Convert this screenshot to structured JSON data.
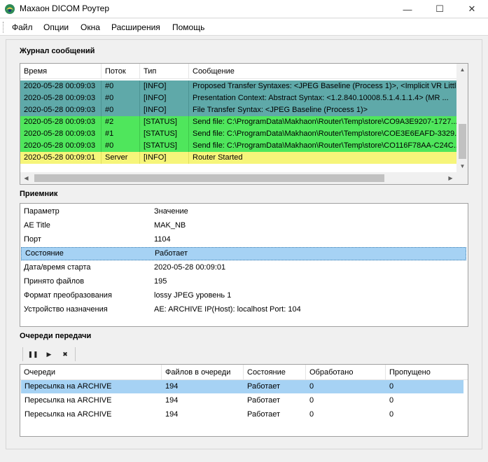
{
  "window": {
    "title": "Махаон DICOM Роутер",
    "minimize": "—",
    "maximize": "☐",
    "close": "✕"
  },
  "menu": [
    "Файл",
    "Опции",
    "Окна",
    "Расширения",
    "Помощь"
  ],
  "log": {
    "title": "Журнал сообщений",
    "columns": [
      "Время",
      "Поток",
      "Тип",
      "Сообщение"
    ],
    "rows": [
      {
        "time": "2020-05-28 00:09:03",
        "thread": "#0",
        "type": "[INFO]",
        "message": "Proposed Transfer Syntaxes: <JPEG Baseline (Process 1)>, <Implicit VR Littl...",
        "color": "#5fa9a9"
      },
      {
        "time": "2020-05-28 00:09:03",
        "thread": "#0",
        "type": "[INFO]",
        "message": "Presentation Context: Abstract Syntax: <1.2.840.10008.5.1.4.1.1.4> (MR ...",
        "color": "#5fa9a9"
      },
      {
        "time": "2020-05-28 00:09:03",
        "thread": "#0",
        "type": "[INFO]",
        "message": "File Transfer Syntax: <JPEG Baseline (Process 1)>",
        "color": "#5fa9a9"
      },
      {
        "time": "2020-05-28 00:09:03",
        "thread": "#2",
        "type": "[STATUS]",
        "message": "Send file: C:\\ProgramData\\Makhaon\\Router\\Temp\\store\\CO9A3E9207-1727...",
        "color": "#4fe65c"
      },
      {
        "time": "2020-05-28 00:09:03",
        "thread": "#1",
        "type": "[STATUS]",
        "message": "Send file: C:\\ProgramData\\Makhaon\\Router\\Temp\\store\\COE3E6EAFD-3329...",
        "color": "#4fe65c"
      },
      {
        "time": "2020-05-28 00:09:03",
        "thread": "#0",
        "type": "[STATUS]",
        "message": "Send file: C:\\ProgramData\\Makhaon\\Router\\Temp\\store\\CO116F78AA-C24C...",
        "color": "#4fe65c"
      },
      {
        "time": "2020-05-28 00:09:01",
        "thread": "Server",
        "type": "[INFO]",
        "message": "Router Started",
        "color": "#f6f57a"
      }
    ]
  },
  "receiver": {
    "title": "Приемник",
    "header": {
      "param": "Параметр",
      "value": "Значение"
    },
    "rows": [
      {
        "param": "AE Title",
        "value": "MAK_NB"
      },
      {
        "param": "Порт",
        "value": "1104"
      },
      {
        "param": "Состояние",
        "value": "Работает"
      },
      {
        "param": "Дата/время старта",
        "value": "2020-05-28 00:09:01"
      },
      {
        "param": "Принято файлов",
        "value": "195"
      },
      {
        "param": "Формат преобразования",
        "value": "lossy JPEG уровень 1"
      },
      {
        "param": "Устройство назначения",
        "value": "AE: ARCHIVE IP(Host): localhost Port: 104"
      }
    ]
  },
  "queues": {
    "title": "Очереди передачи",
    "toolbar": {
      "pause": "❚❚",
      "play": "▶",
      "stop": "✖"
    },
    "columns": [
      "Очереди",
      "Файлов в очереди",
      "Состояние",
      "Обработано",
      "Пропущено"
    ],
    "rows": [
      {
        "name": "Пересылка на ARCHIVE",
        "files": "194",
        "state": "Работает",
        "processed": "0",
        "skipped": "0"
      },
      {
        "name": "Пересылка на ARCHIVE",
        "files": "194",
        "state": "Работает",
        "processed": "0",
        "skipped": "0"
      },
      {
        "name": "Пересылка на ARCHIVE",
        "files": "194",
        "state": "Работает",
        "processed": "0",
        "skipped": "0"
      }
    ]
  }
}
